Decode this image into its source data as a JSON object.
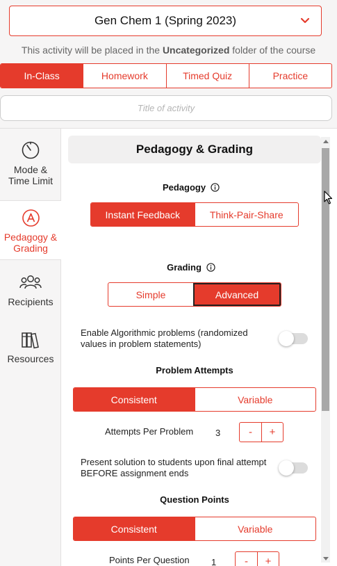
{
  "course_select": {
    "value": "Gen Chem 1 (Spring 2023)",
    "icon": "chevron-down-icon"
  },
  "folder_note": {
    "prefix": "This activity will be placed in the ",
    "folder": "Uncategorized",
    "suffix": " folder of the course"
  },
  "activity_types": [
    {
      "label": "In-Class",
      "active": true
    },
    {
      "label": "Homework",
      "active": false
    },
    {
      "label": "Timed Quiz",
      "active": false
    },
    {
      "label": "Practice",
      "active": false
    }
  ],
  "title_input": {
    "placeholder": "Title of activity",
    "value": ""
  },
  "sidebar": {
    "items": [
      {
        "label_line1": "Mode &",
        "label_line2": "Time Limit",
        "icon": "timer-icon",
        "active": false
      },
      {
        "label_line1": "Pedagogy &",
        "label_line2": "Grading",
        "icon": "pedagogy-icon",
        "active": true
      },
      {
        "label_line1": "Recipients",
        "label_line2": "",
        "icon": "users-icon",
        "active": false
      },
      {
        "label_line1": "Resources",
        "label_line2": "",
        "icon": "books-icon",
        "active": false
      }
    ]
  },
  "main": {
    "section_title": "Pedagogy & Grading",
    "pedagogy": {
      "label": "Pedagogy",
      "options": [
        {
          "label": "Instant Feedback",
          "active": true
        },
        {
          "label": "Think-Pair-Share",
          "active": false
        }
      ]
    },
    "grading": {
      "label": "Grading",
      "options": [
        {
          "label": "Simple",
          "active": false
        },
        {
          "label": "Advanced",
          "active": true
        }
      ]
    },
    "algorithmic_toggle": {
      "label": "Enable Algorithmic problems (randomized values in problem statements)",
      "on": false
    },
    "problem_attempts": {
      "label": "Problem Attempts",
      "options": [
        {
          "label": "Consistent",
          "active": true
        },
        {
          "label": "Variable",
          "active": false
        }
      ],
      "per_problem_label": "Attempts Per Problem",
      "per_problem_value": "3",
      "minus": "-",
      "plus": "+"
    },
    "solution_toggle": {
      "label": "Present solution to students upon final attempt BEFORE assignment ends",
      "on": false
    },
    "question_points": {
      "label": "Question Points",
      "options": [
        {
          "label": "Consistent",
          "active": true
        },
        {
          "label": "Variable",
          "active": false
        }
      ],
      "per_question_label": "Points Per Question",
      "per_question_value": "1",
      "minus": "-",
      "plus": "+"
    }
  },
  "colors": {
    "accent": "#e53b2c",
    "sidebar_bg": "#f6f5f5",
    "header_bg": "#f1f0f0"
  }
}
